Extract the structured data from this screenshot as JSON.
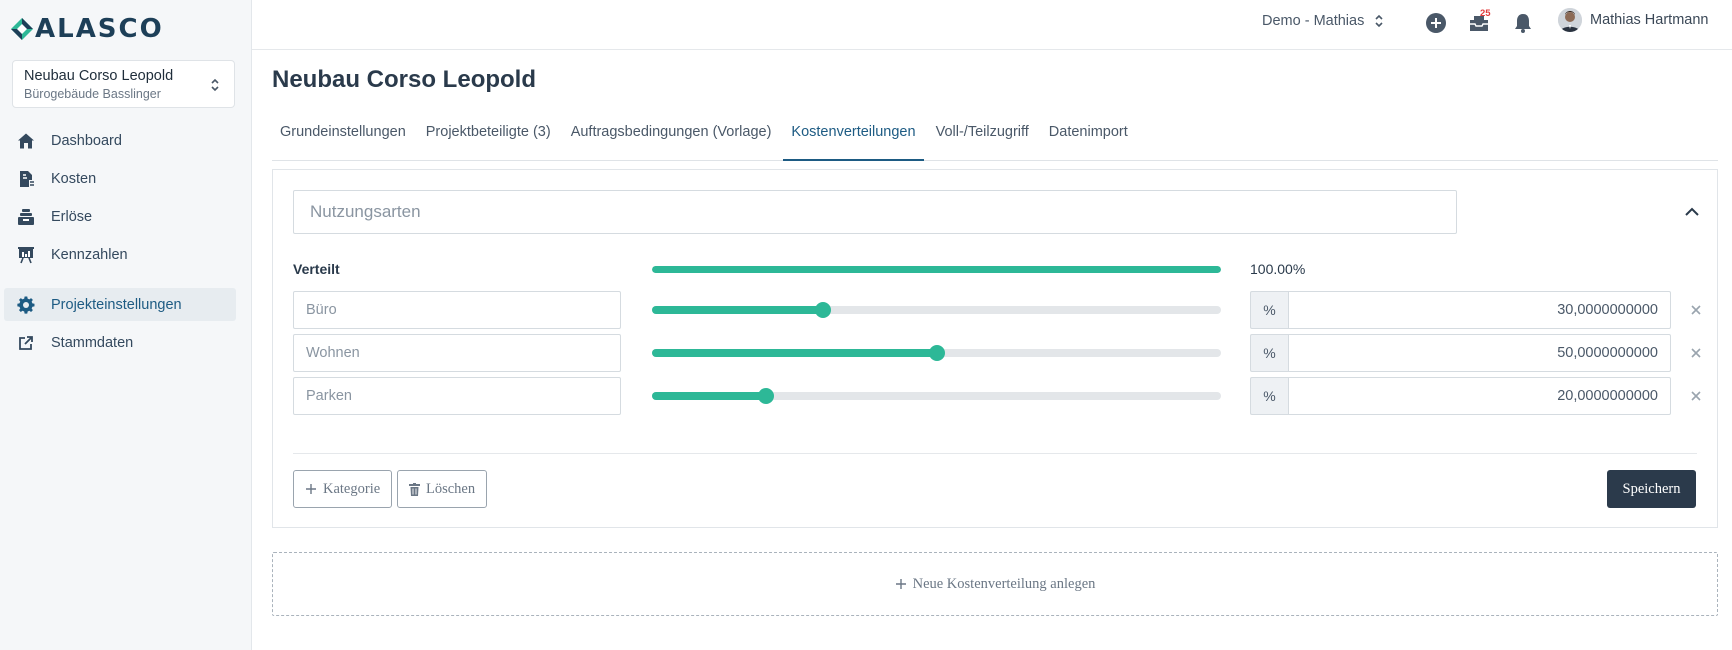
{
  "app": {
    "logo_text": "ALASCO"
  },
  "project": {
    "name": "Neubau Corso Leopold",
    "subtitle": "Bürogebäude Basslinger"
  },
  "sidebar": {
    "items": [
      {
        "label": "Dashboard",
        "icon": "home-icon"
      },
      {
        "label": "Kosten",
        "icon": "cost-icon"
      },
      {
        "label": "Erlöse",
        "icon": "revenue-icon"
      },
      {
        "label": "Kennzahlen",
        "icon": "chart-icon"
      },
      {
        "label": "Projekteinstellungen",
        "icon": "gear-icon",
        "active": true
      },
      {
        "label": "Stammdaten",
        "icon": "external-link-icon"
      }
    ]
  },
  "topbar": {
    "workspace": "Demo - Mathias",
    "inbox_badge": "25",
    "user_name": "Mathias Hartmann"
  },
  "main": {
    "page_title": "Neubau Corso Leopold",
    "tabs": [
      {
        "label": "Grundeinstellungen"
      },
      {
        "label": "Projektbeteiligte (3)"
      },
      {
        "label": "Auftragsbedingungen (Vorlage)"
      },
      {
        "label": "Kostenverteilungen",
        "active": true
      },
      {
        "label": "Voll-/Teilzugriff"
      },
      {
        "label": "Datenimport"
      }
    ]
  },
  "distribution": {
    "name_placeholder": "Nutzungsarten",
    "verteilt_label": "Verteilt",
    "total_display": "100.00%",
    "total_fraction": 1.0,
    "percent_symbol": "%",
    "rows": [
      {
        "placeholder": "Büro",
        "value": "30,0000000000",
        "fraction": 0.3
      },
      {
        "placeholder": "Wohnen",
        "value": "50,0000000000",
        "fraction": 0.5
      },
      {
        "placeholder": "Parken",
        "value": "20,0000000000",
        "fraction": 0.2
      }
    ],
    "add_category_label": "Kategorie",
    "delete_label": "Löschen",
    "save_label": "Speichern"
  },
  "new_distribution_label": "Neue Kostenverteilung anlegen",
  "colors": {
    "accent": "#2db897",
    "primary_dark": "#2b3a4b",
    "active_link": "#1d5b83",
    "badge": "#e23b3b"
  }
}
